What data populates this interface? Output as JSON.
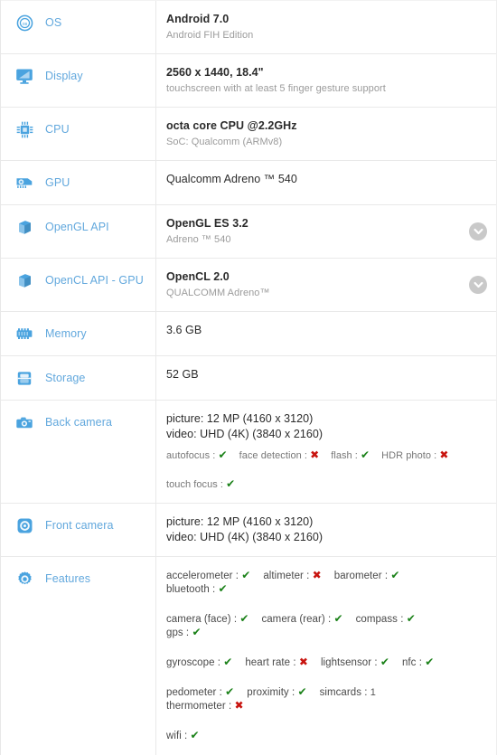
{
  "device_spec_sheet": {
    "rows": [
      {
        "key": "os",
        "icon": "os-badge-icon",
        "label": "OS",
        "primary": "Android 7.0",
        "secondary": "Android FIH Edition",
        "expandable": false
      },
      {
        "key": "display",
        "icon": "monitor-icon",
        "label": "Display",
        "primary": "2560 x 1440, 18.4\"",
        "secondary": "touchscreen with at least 5 finger gesture support",
        "expandable": false
      },
      {
        "key": "cpu",
        "icon": "cpu-chip-icon",
        "label": "CPU",
        "primary": "octa core CPU @2.2GHz",
        "secondary": "SoC: Qualcomm (ARMv8)",
        "expandable": false
      },
      {
        "key": "gpu",
        "icon": "gpu-card-icon",
        "label": "GPU",
        "primary": "Qualcomm Adreno ™ 540",
        "secondary": "",
        "expandable": false
      },
      {
        "key": "opengl_api",
        "icon": "cube-3d-icon",
        "label": "OpenGL API",
        "primary": "OpenGL ES 3.2",
        "secondary": "Adreno ™ 540",
        "expandable": true
      },
      {
        "key": "opencl_api_gpu",
        "icon": "cube-3d-icon",
        "label": "OpenCL API - GPU",
        "primary": "OpenCL 2.0",
        "secondary": "QUALCOMM Adreno™",
        "expandable": true
      },
      {
        "key": "memory",
        "icon": "memory-ram-icon",
        "label": "Memory",
        "primary": "3.6 GB",
        "secondary": "",
        "expandable": false
      },
      {
        "key": "storage",
        "icon": "storage-drive-icon",
        "label": "Storage",
        "primary": "52 GB",
        "secondary": "",
        "expandable": false
      }
    ],
    "back_camera": {
      "key": "back_camera",
      "icon": "camera-icon",
      "label": "Back camera",
      "picture": "picture: 12 MP (4160 x 3120)",
      "video": "video: UHD (4K) (3840 x 2160)",
      "flags_line1": [
        {
          "name": "autofocus",
          "separator": ":",
          "value": "✔",
          "state": "yes"
        },
        {
          "name": "face detection",
          "separator": ":",
          "value": "✖",
          "state": "no"
        },
        {
          "name": "flash",
          "separator": ":",
          "value": "✔",
          "state": "yes"
        },
        {
          "name": "HDR photo",
          "separator": ":",
          "value": "✖",
          "state": "no"
        }
      ],
      "flags_line2": [
        {
          "name": "touch focus",
          "separator": ":",
          "value": "✔",
          "state": "yes"
        }
      ]
    },
    "front_camera": {
      "key": "front_camera",
      "icon": "front-camera-icon",
      "label": "Front camera",
      "picture": "picture: 12 MP (4160 x 3120)",
      "video": "video: UHD (4K) (3840 x 2160)"
    },
    "features": {
      "key": "features",
      "icon": "gear-icon",
      "label": "Features",
      "lines": [
        [
          {
            "name": "accelerometer",
            "separator": ":",
            "value": "✔",
            "state": "yes"
          },
          {
            "name": "altimeter",
            "separator": ":",
            "value": "✖",
            "state": "no"
          },
          {
            "name": "barometer",
            "separator": ":",
            "value": "✔",
            "state": "yes"
          },
          {
            "name": "bluetooth",
            "separator": ":",
            "value": "✔",
            "state": "yes"
          }
        ],
        [
          {
            "name": "camera (face)",
            "separator": ":",
            "value": "✔",
            "state": "yes"
          },
          {
            "name": "camera (rear)",
            "separator": ":",
            "value": "✔",
            "state": "yes"
          },
          {
            "name": "compass",
            "separator": ":",
            "value": "✔",
            "state": "yes"
          },
          {
            "name": "gps",
            "separator": ":",
            "value": "✔",
            "state": "yes"
          }
        ],
        [
          {
            "name": "gyroscope",
            "separator": ":",
            "value": "✔",
            "state": "yes"
          },
          {
            "name": "heart rate",
            "separator": ":",
            "value": "✖",
            "state": "no"
          },
          {
            "name": "lightsensor",
            "separator": ":",
            "value": "✔",
            "state": "yes"
          },
          {
            "name": "nfc",
            "separator": ":",
            "value": "✔",
            "state": "yes"
          }
        ],
        [
          {
            "name": "pedometer",
            "separator": ":",
            "value": "✔",
            "state": "yes"
          },
          {
            "name": "proximity",
            "separator": ":",
            "value": "✔",
            "state": "yes"
          },
          {
            "name": "simcards",
            "separator": ":",
            "value": "1",
            "state": "num"
          },
          {
            "name": "thermometer",
            "separator": ":",
            "value": "✖",
            "state": "no"
          }
        ],
        [
          {
            "name": "wifi",
            "separator": ":",
            "value": "✔",
            "state": "yes"
          }
        ]
      ]
    },
    "colors": {
      "label_blue": "#62a8dd",
      "icon_blue": "#4aa3df",
      "value_dark": "#2b2b2b",
      "value_muted": "#9b9b9b",
      "check_green": "#1a8118",
      "cross_red": "#c8140f",
      "chevron_gray": "#c9c9c9",
      "row_divider": "#e9e9e9"
    }
  }
}
